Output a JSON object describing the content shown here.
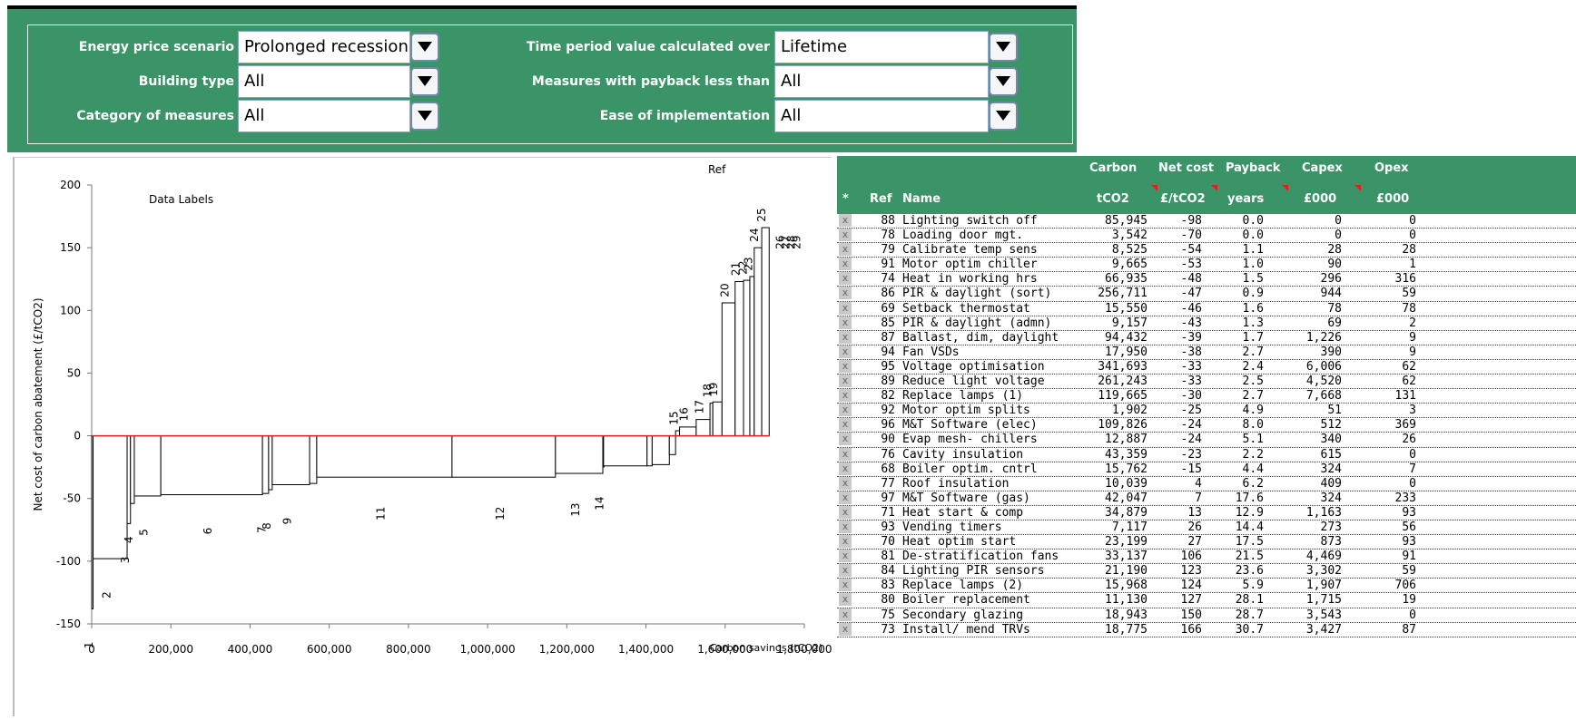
{
  "filters": {
    "left": [
      {
        "label": "Energy price scenario",
        "value": "Prolonged recession"
      },
      {
        "label": "Building type",
        "value": "All"
      },
      {
        "label": "Category of measures",
        "value": "All"
      }
    ],
    "right": [
      {
        "label": "Time period value calculated over",
        "value": "Lifetime"
      },
      {
        "label": "Measures with payback less than",
        "value": "All"
      },
      {
        "label": "Ease of implementation",
        "value": "All"
      }
    ]
  },
  "chart_data": {
    "type": "bar",
    "subtype": "marginal-abatement-cost-curve",
    "title": "",
    "xlabel": "Carbon savings (tCO2)",
    "ylabel": "Net cost of carbon abatement (£/tCO2)",
    "xlim": [
      0,
      1800000
    ],
    "ylim": [
      -150,
      200
    ],
    "xticks": [
      "0",
      "200,000",
      "400,000",
      "600,000",
      "800,000",
      "1,000,000",
      "1,200,000",
      "1,400,000",
      "1,600,000",
      "1,800,000"
    ],
    "yticks": [
      "200",
      "150",
      "100",
      "50",
      "0",
      "-50",
      "-100",
      "-150"
    ],
    "annotations": [
      "Data Labels",
      "Ref"
    ],
    "baseline_color": "#e02020",
    "bars": [
      {
        "label": "1",
        "width": 3542,
        "value": -138
      },
      {
        "label": "2",
        "width": 85945,
        "value": -98
      },
      {
        "label": "3",
        "width": 8525,
        "value": -70
      },
      {
        "label": "4",
        "width": 9665,
        "value": -54
      },
      {
        "label": "5",
        "width": 66935,
        "value": -48
      },
      {
        "label": "6",
        "width": 256711,
        "value": -47
      },
      {
        "label": "7",
        "width": 15550,
        "value": -46
      },
      {
        "label": "8",
        "width": 9157,
        "value": -43
      },
      {
        "label": "9",
        "width": 94432,
        "value": -39
      },
      {
        "label": "",
        "width": 17950,
        "value": -38
      },
      {
        "label": "11",
        "width": 341693,
        "value": -33
      },
      {
        "label": "12",
        "width": 261243,
        "value": -33
      },
      {
        "label": "13",
        "width": 119665,
        "value": -30
      },
      {
        "label": "14",
        "width": 1902,
        "value": -25
      },
      {
        "label": "",
        "width": 109826,
        "value": -24
      },
      {
        "label": "",
        "width": 12887,
        "value": -24
      },
      {
        "label": "",
        "width": 43359,
        "value": -23
      },
      {
        "label": "",
        "width": 15762,
        "value": -15
      },
      {
        "label": "15",
        "width": 10039,
        "value": 4
      },
      {
        "label": "16",
        "width": 42047,
        "value": 7
      },
      {
        "label": "17",
        "width": 34879,
        "value": 13
      },
      {
        "label": "18",
        "width": 7117,
        "value": 26
      },
      {
        "label": "19",
        "width": 23199,
        "value": 27
      },
      {
        "label": "20",
        "width": 33137,
        "value": 106
      },
      {
        "label": "21",
        "width": 21190,
        "value": 123
      },
      {
        "label": "22",
        "width": 15968,
        "value": 124
      },
      {
        "label": "23",
        "width": 11130,
        "value": 127
      },
      {
        "label": "24",
        "width": 18943,
        "value": 150
      },
      {
        "label": "25",
        "width": 18775,
        "value": 166
      },
      {
        "label": "26",
        "width": 0,
        "value": 0
      },
      {
        "label": "27",
        "width": 0,
        "value": 0
      },
      {
        "label": "28",
        "width": 0,
        "value": 0
      },
      {
        "label": "29",
        "width": 0,
        "value": 0
      }
    ]
  },
  "table": {
    "header_top": {
      "carbon": "Carbon",
      "net": "Net cost",
      "payback": "Payback",
      "capex": "Capex",
      "opex": "Opex"
    },
    "header_bottom": {
      "star": "*",
      "ref": "Ref",
      "name": "Name",
      "carbon": "tCO2",
      "net": "£/tCO2",
      "payback": "years",
      "capex": "£000",
      "opex": "£000"
    },
    "remove_mark": "x",
    "rows": [
      [
        "88",
        "Lighting switch off",
        "85,945",
        "-98",
        "0.0",
        "0",
        "0"
      ],
      [
        "78",
        "Loading door mgt.",
        "3,542",
        "-70",
        "0.0",
        "0",
        "0"
      ],
      [
        "79",
        "Calibrate temp sens",
        "8,525",
        "-54",
        "1.1",
        "28",
        "28"
      ],
      [
        "91",
        "Motor optim chiller",
        "9,665",
        "-53",
        "1.0",
        "90",
        "1"
      ],
      [
        "74",
        "Heat in working hrs",
        "66,935",
        "-48",
        "1.5",
        "296",
        "316"
      ],
      [
        "86",
        "PIR & daylight (sort)",
        "256,711",
        "-47",
        "0.9",
        "944",
        "59"
      ],
      [
        "69",
        "Setback thermostat",
        "15,550",
        "-46",
        "1.6",
        "78",
        "78"
      ],
      [
        "85",
        "PIR & daylight (admn)",
        "9,157",
        "-43",
        "1.3",
        "69",
        "2"
      ],
      [
        "87",
        "Ballast, dim, daylight",
        "94,432",
        "-39",
        "1.7",
        "1,226",
        "9"
      ],
      [
        "94",
        "Fan VSDs",
        "17,950",
        "-38",
        "2.7",
        "390",
        "9"
      ],
      [
        "95",
        "Voltage optimisation",
        "341,693",
        "-33",
        "2.4",
        "6,006",
        "62"
      ],
      [
        "89",
        "Reduce light voltage",
        "261,243",
        "-33",
        "2.5",
        "4,520",
        "62"
      ],
      [
        "82",
        "Replace lamps (1)",
        "119,665",
        "-30",
        "2.7",
        "7,668",
        "131"
      ],
      [
        "92",
        "Motor optim splits",
        "1,902",
        "-25",
        "4.9",
        "51",
        "3"
      ],
      [
        "96",
        "M&T Software (elec)",
        "109,826",
        "-24",
        "8.0",
        "512",
        "369"
      ],
      [
        "90",
        "Evap mesh- chillers",
        "12,887",
        "-24",
        "5.1",
        "340",
        "26"
      ],
      [
        "76",
        "Cavity insulation",
        "43,359",
        "-23",
        "2.2",
        "615",
        "0"
      ],
      [
        "68",
        "Boiler optim. cntrl",
        "15,762",
        "-15",
        "4.4",
        "324",
        "7"
      ],
      [
        "77",
        "Roof insulation",
        "10,039",
        "4",
        "6.2",
        "409",
        "0"
      ],
      [
        "97",
        "M&T Software (gas)",
        "42,047",
        "7",
        "17.6",
        "324",
        "233"
      ],
      [
        "71",
        "Heat start & comp",
        "34,879",
        "13",
        "12.9",
        "1,163",
        "93"
      ],
      [
        "93",
        "Vending timers",
        "7,117",
        "26",
        "14.4",
        "273",
        "56"
      ],
      [
        "70",
        "Heat optim start",
        "23,199",
        "27",
        "17.5",
        "873",
        "93"
      ],
      [
        "81",
        "De-stratification fans",
        "33,137",
        "106",
        "21.5",
        "4,469",
        "91"
      ],
      [
        "84",
        "Lighting PIR sensors",
        "21,190",
        "123",
        "23.6",
        "3,302",
        "59"
      ],
      [
        "83",
        "Replace lamps (2)",
        "15,968",
        "124",
        "5.9",
        "1,907",
        "706"
      ],
      [
        "80",
        "Boiler replacement",
        "11,130",
        "127",
        "28.1",
        "1,715",
        "19"
      ],
      [
        "75",
        "Secondary glazing",
        "18,943",
        "150",
        "28.7",
        "3,543",
        "0"
      ],
      [
        "73",
        "Install/ mend TRVs",
        "18,775",
        "166",
        "30.7",
        "3,427",
        "87"
      ]
    ]
  }
}
